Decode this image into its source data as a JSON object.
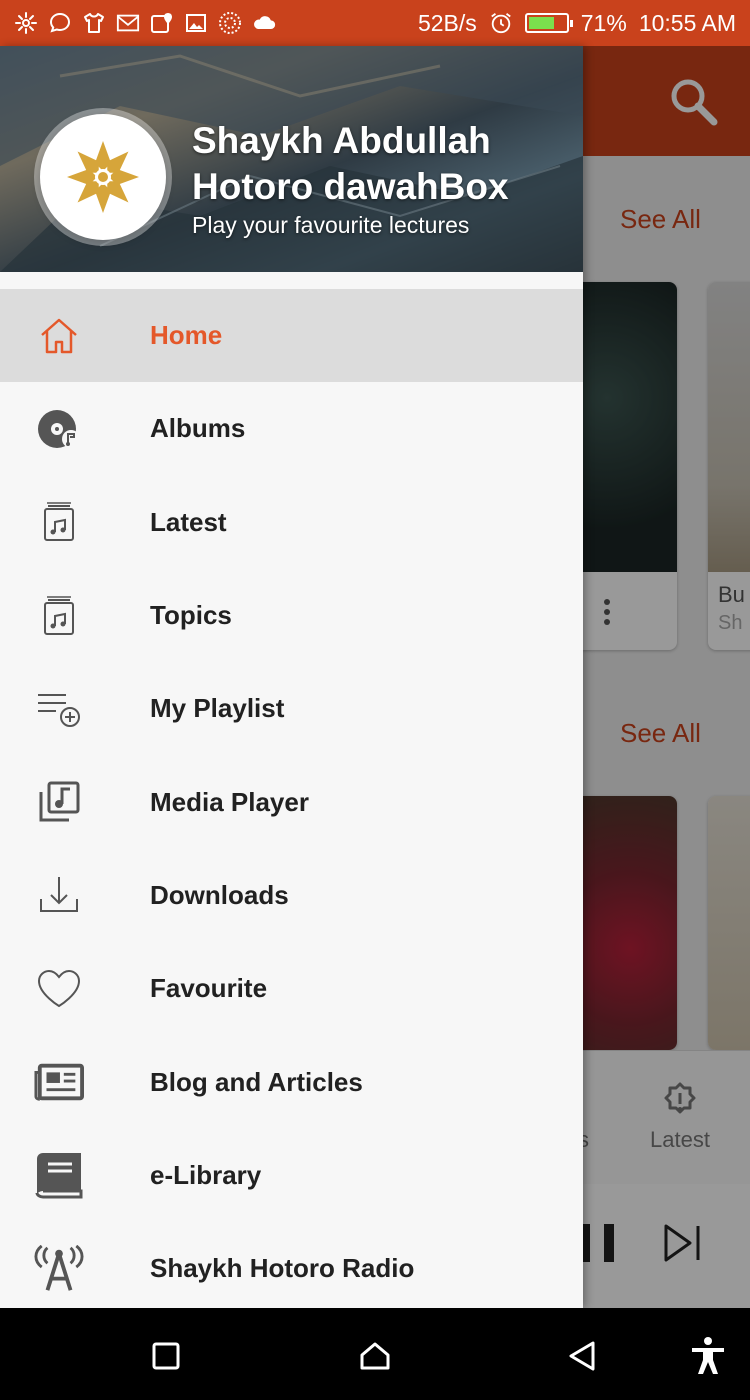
{
  "status_bar": {
    "net_speed": "52B/s",
    "battery_percent": "71%",
    "battery_level": 0.71,
    "time": "10:55 AM",
    "icons": [
      "spinner-icon",
      "chat-icon",
      "shirt-icon",
      "gmail-icon",
      "location-icon",
      "image-icon",
      "dotted-circle-icon",
      "cloud-icon",
      "alarm-icon",
      "battery-icon"
    ],
    "bg_color": "#c9421c"
  },
  "background": {
    "see_all_1": "See All",
    "see_all_2": "See All",
    "card_text_1": "Bu",
    "card_text_2": "Sh",
    "bottom_nav_latest": "Latest",
    "bottom_nav_partial": "s"
  },
  "drawer": {
    "header": {
      "title": "Shaykh Abdullah Hotoro dawahBox",
      "subtitle": "Play your favourite lectures"
    },
    "items": [
      {
        "label": "Home",
        "icon": "home-icon",
        "active": true
      },
      {
        "label": "Albums",
        "icon": "vinyl-music-icon",
        "active": false
      },
      {
        "label": "Latest",
        "icon": "music-file-icon",
        "active": false
      },
      {
        "label": "Topics",
        "icon": "music-file-icon",
        "active": false
      },
      {
        "label": "My Playlist",
        "icon": "playlist-add-icon",
        "active": false
      },
      {
        "label": "Media Player",
        "icon": "music-library-icon",
        "active": false
      },
      {
        "label": "Downloads",
        "icon": "download-icon",
        "active": false
      },
      {
        "label": "Favourite",
        "icon": "heart-icon",
        "active": false
      },
      {
        "label": "Blog and Articles",
        "icon": "newspaper-icon",
        "active": false
      },
      {
        "label": "e-Library",
        "icon": "book-icon",
        "active": false
      },
      {
        "label": "Shaykh Hotoro Radio",
        "icon": "radio-antenna-icon",
        "active": false
      }
    ]
  },
  "colors": {
    "accent": "#e4582a",
    "primary": "#c9421c",
    "active_bg": "#dcdcdc"
  }
}
